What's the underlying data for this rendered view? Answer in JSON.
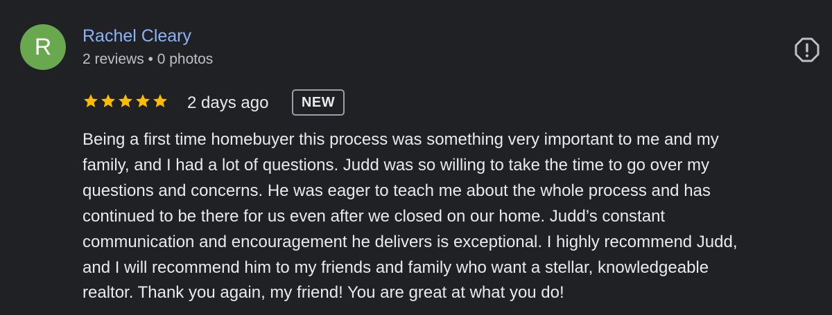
{
  "review": {
    "reviewer": {
      "initial": "R",
      "name": "Rachel Cleary",
      "meta": "2 reviews • 0 photos",
      "avatar_color": "#6aa84f"
    },
    "rating": 5,
    "rating_max": 5,
    "star_color": "#fbbc04",
    "time_ago": "2 days ago",
    "badge": "NEW",
    "report_icon": "report-flag-icon",
    "text_lines": [
      "Being a first time homebuyer this process was something very important to me and my",
      "family, and I had a lot of questions. Judd was so willing to take the time to go over my",
      "questions and concerns. He was eager to teach me about the whole process and has",
      "continued to be there for us even after we closed on our home. Judd’s constant",
      "communication and encouragement he delivers is exceptional. I highly recommend Judd,",
      "and I will recommend him to my friends and family who want a stellar, knowledgeable",
      "realtor. Thank you again, my friend! You are great at what you do!"
    ]
  },
  "colors": {
    "background": "#202124",
    "link": "#8ab4f8",
    "text": "#e8eaed",
    "secondary_text": "#bdc1c6"
  }
}
